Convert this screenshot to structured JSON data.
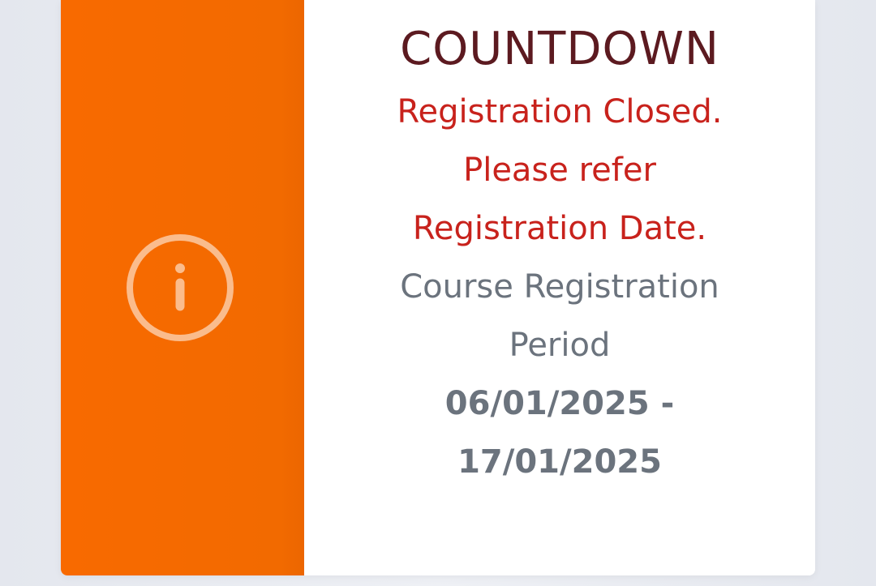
{
  "card": {
    "icon": "info-circle-icon",
    "accent_color": "#f86a00",
    "title": "COUNTDOWN",
    "status_message": "Registration Closed. Please refer Registration Date.",
    "period_label": "Course Registration Period",
    "period_dates": "06/01/2025 - 17/01/2025"
  },
  "colors": {
    "title": "#5c1a20",
    "status": "#c8221c",
    "text": "#6b737d",
    "background": "#e9ecf2"
  }
}
